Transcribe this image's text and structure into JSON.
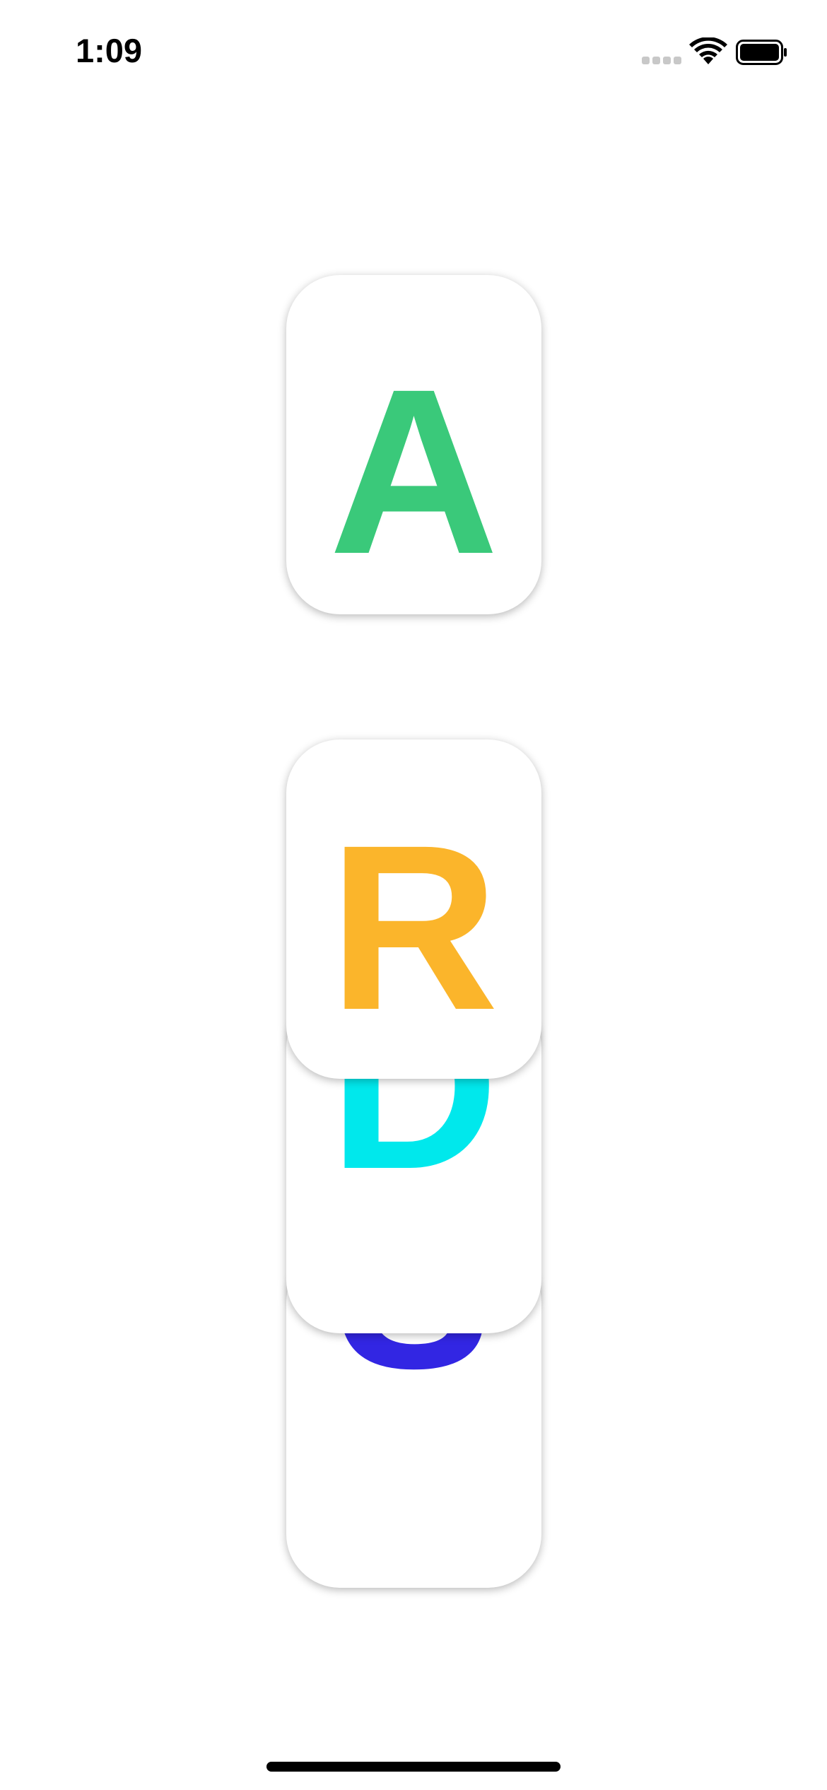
{
  "status_bar": {
    "time": "1:09",
    "icons": [
      "signal-icon",
      "wifi-icon",
      "battery-icon"
    ]
  },
  "cards": [
    {
      "letter": "A",
      "color": "#3ac97a"
    },
    {
      "letter": "R",
      "color": "#fbb52b"
    },
    {
      "letter": "D",
      "color": "#00e8ec"
    },
    {
      "letter": "S",
      "color": "#3226e3"
    }
  ],
  "colors": {
    "background": "#ffffff",
    "card_background": "#ffffff",
    "text_primary": "#000000"
  }
}
